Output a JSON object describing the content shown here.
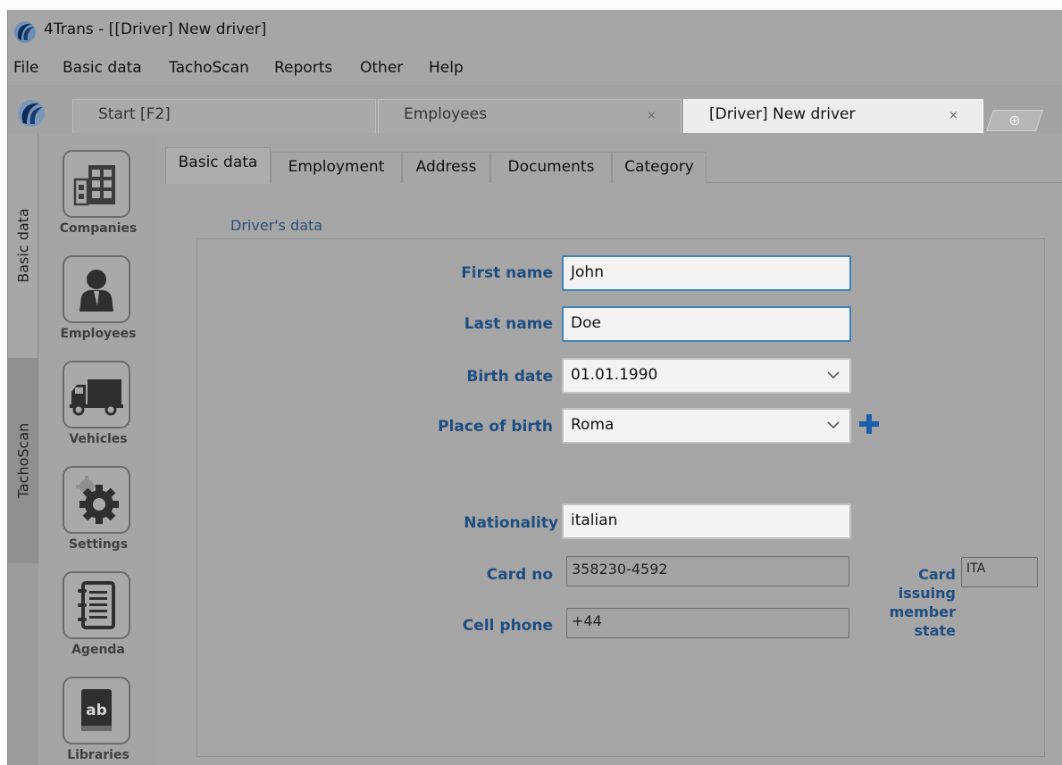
{
  "window": {
    "title": "4Trans - [[Driver] New driver]"
  },
  "menu": [
    "File",
    "Basic data",
    "TachoScan",
    "Reports",
    "Other",
    "Help"
  ],
  "doc_tabs": [
    {
      "label": "Start [F2]",
      "closable": false
    },
    {
      "label": "Employees",
      "closable": true
    },
    {
      "label": "[Driver] New driver",
      "closable": true
    }
  ],
  "tab_close_glyph": "×",
  "add_tab_glyph": "⊕",
  "vertical_tabs": [
    "Basic data",
    "TachoScan"
  ],
  "launcher": [
    {
      "label": "Companies",
      "icon": "building-icon"
    },
    {
      "label": "Employees",
      "icon": "person-icon"
    },
    {
      "label": "Vehicles",
      "icon": "truck-icon"
    },
    {
      "label": "Settings",
      "icon": "gear-icon"
    },
    {
      "label": "Agenda",
      "icon": "notebook-icon"
    },
    {
      "label": "Libraries",
      "icon": "dictionary-icon"
    }
  ],
  "content_tabs": [
    "Basic data",
    "Employment",
    "Address",
    "Documents",
    "Category"
  ],
  "form": {
    "group_title": "Driver's data",
    "first_name": {
      "label": "First name",
      "value": "John"
    },
    "last_name": {
      "label": "Last name",
      "value": "Doe"
    },
    "birth_date": {
      "label": "Birth date",
      "value": "01.01.1990"
    },
    "place_of_birth": {
      "label": "Place of birth",
      "value": "Roma"
    },
    "nationality": {
      "label": "Nationality",
      "value": "italian"
    },
    "card_no": {
      "label": "Card no",
      "value": "358230-4592"
    },
    "cell_phone": {
      "label": "Cell phone",
      "value": "+44"
    },
    "card_issuing_state": {
      "label": "Card\nissuing\nmember\nstate",
      "value": "ITA"
    }
  },
  "colors": {
    "accent": "#1f4d80",
    "focus_border": "#3e83b8",
    "plus": "#1e5ea8"
  }
}
